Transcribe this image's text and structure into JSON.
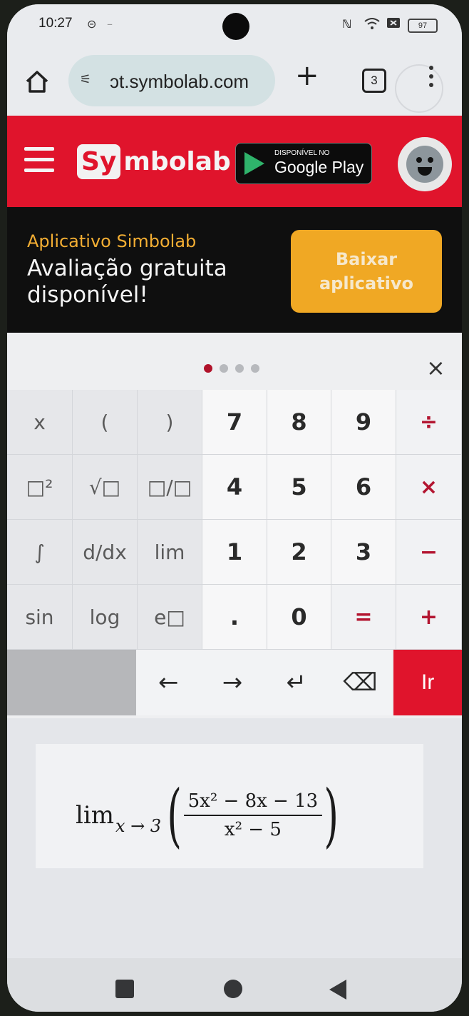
{
  "status_bar": {
    "time": "10:27",
    "battery": "97"
  },
  "browser": {
    "url": "ɔt.symbolab.com",
    "tab_count": "3"
  },
  "site_header": {
    "logo_box": "Sy",
    "logo_rest": "mbolab",
    "gplay_small": "DISPONÍVEL NO",
    "gplay_big": "Google Play"
  },
  "promo": {
    "kicker": "Aplicativo Simbolab",
    "title": "Avaliação gratuita disponível!",
    "button": "Baixar aplicativo"
  },
  "keypad": {
    "keys": [
      {
        "label": "x",
        "type": "gray"
      },
      {
        "label": "(",
        "type": "gray"
      },
      {
        "label": ")",
        "type": "gray"
      },
      {
        "label": "7",
        "type": "num"
      },
      {
        "label": "8",
        "type": "num"
      },
      {
        "label": "9",
        "type": "num"
      },
      {
        "label": "÷",
        "type": "op"
      },
      {
        "label": "□²",
        "type": "gray"
      },
      {
        "label": "√□",
        "type": "gray"
      },
      {
        "label": "□/□",
        "type": "gray"
      },
      {
        "label": "4",
        "type": "num"
      },
      {
        "label": "5",
        "type": "num"
      },
      {
        "label": "6",
        "type": "num"
      },
      {
        "label": "×",
        "type": "op"
      },
      {
        "label": "∫",
        "type": "gray"
      },
      {
        "label": "d/dx",
        "type": "gray"
      },
      {
        "label": "lim",
        "type": "gray"
      },
      {
        "label": "1",
        "type": "num"
      },
      {
        "label": "2",
        "type": "num"
      },
      {
        "label": "3",
        "type": "num"
      },
      {
        "label": "−",
        "type": "op"
      },
      {
        "label": "sin",
        "type": "gray"
      },
      {
        "label": "log",
        "type": "gray"
      },
      {
        "label": "e□",
        "type": "gray"
      },
      {
        "label": ".",
        "type": "num"
      },
      {
        "label": "0",
        "type": "num"
      },
      {
        "label": "=",
        "type": "op"
      },
      {
        "label": "+",
        "type": "op"
      }
    ],
    "nav": {
      "left": "←",
      "right": "→",
      "enter": "↵",
      "backspace": "⌫",
      "go": "Ir"
    },
    "page_count": 4,
    "active_page": 0,
    "close": "×"
  },
  "expression": {
    "lim": "lim",
    "subscript": "x → 3",
    "numerator": "5x² − 8x − 13",
    "denominator": "x² − 5"
  },
  "colors": {
    "brand_red": "#e0142c",
    "accent_orange": "#f0a824"
  }
}
